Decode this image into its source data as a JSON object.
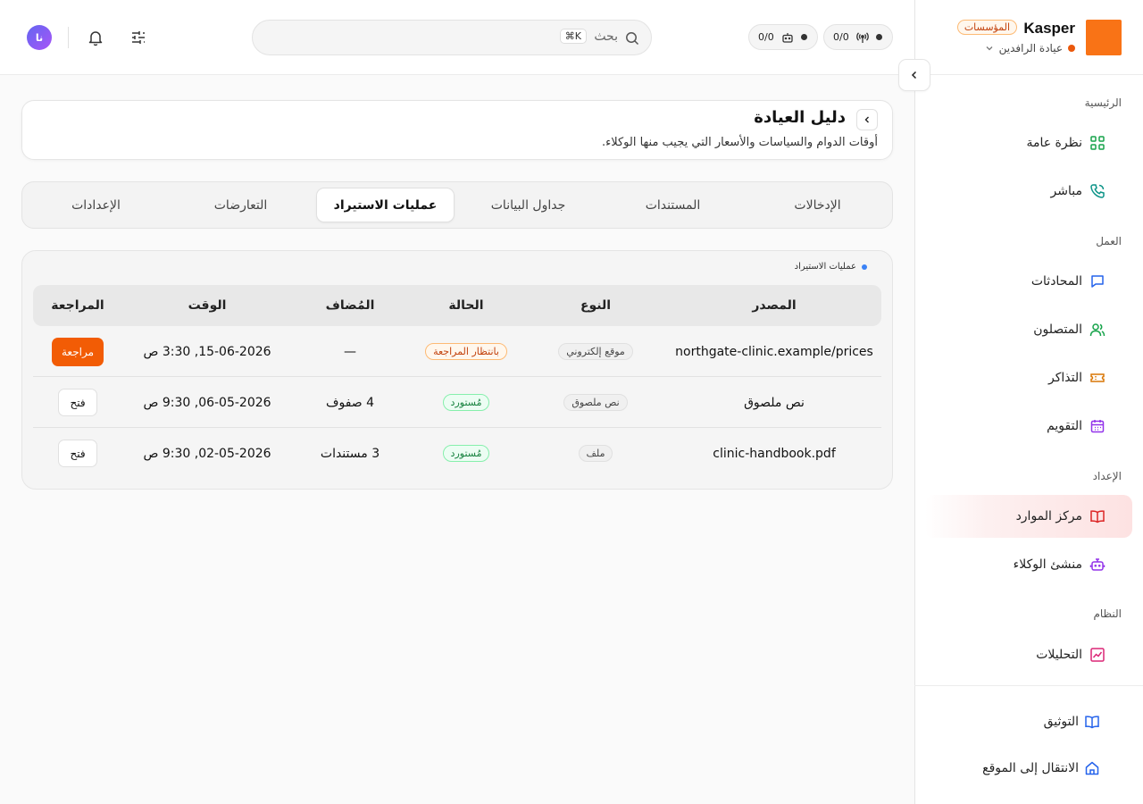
{
  "brand": {
    "name": "Kasper",
    "badge": "المؤسسات",
    "org": "عيادة الرافدين"
  },
  "colors": {
    "accent": "#f25c05",
    "active_nav": "#fde2e2",
    "pending": "#c2410c",
    "imported": "#15803d"
  },
  "topbar": {
    "status_pills": [
      {
        "icon": "antenna-icon",
        "value": "0/0"
      },
      {
        "icon": "robot-icon",
        "value": "0/0"
      }
    ],
    "search": {
      "placeholder": "بحث",
      "shortcut": "⌘K"
    },
    "avatar_initials": "نا"
  },
  "sidebar": {
    "sections": [
      {
        "label": "الرئيسية",
        "items": [
          {
            "label": "نظرة عامة",
            "icon": "grid-icon"
          },
          {
            "label": "مباشر",
            "icon": "phone-icon"
          }
        ]
      },
      {
        "label": "العمل",
        "items": [
          {
            "label": "المحادثات",
            "icon": "chat-icon"
          },
          {
            "label": "المتصلون",
            "icon": "users-icon"
          },
          {
            "label": "التذاكر",
            "icon": "ticket-icon"
          },
          {
            "label": "التقويم",
            "icon": "calendar-icon"
          }
        ]
      },
      {
        "label": "الإعداد",
        "items": [
          {
            "label": "مركز الموارد",
            "icon": "book-icon",
            "active": true
          },
          {
            "label": "منشئ الوكلاء",
            "icon": "bot-icon"
          }
        ]
      },
      {
        "label": "النظام",
        "items": [
          {
            "label": "التحليلات",
            "icon": "chart-icon"
          }
        ]
      }
    ],
    "footer": [
      {
        "label": "التوثيق",
        "icon": "book-icon"
      },
      {
        "label": "الانتقال إلى الموقع",
        "icon": "home-icon"
      }
    ]
  },
  "page": {
    "title": "دليل العيادة",
    "subtitle": "أوقات الدوام والسياسات والأسعار التي يجيب منها الوكلاء."
  },
  "tabs": [
    {
      "label": "الإدخالات"
    },
    {
      "label": "المستندات"
    },
    {
      "label": "جداول البيانات"
    },
    {
      "label": "عمليات الاستيراد",
      "active": true
    },
    {
      "label": "التعارضات"
    },
    {
      "label": "الإعدادات"
    }
  ],
  "imports": {
    "label": "عمليات الاستيراد",
    "columns": [
      "المصدر",
      "النوع",
      "الحالة",
      "المُضاف",
      "الوقت",
      "المراجعة"
    ],
    "rows": [
      {
        "source": "northgate-clinic.example/prices",
        "type": "موقع إلكتروني",
        "status": "بانتظار المراجعة",
        "status_kind": "pending",
        "added": "—",
        "time": "15-06-2026, 3:30 ص",
        "action": "مراجعة"
      },
      {
        "source": "نص ملصوق",
        "type": "نص ملصوق",
        "status": "مُستورد",
        "status_kind": "done",
        "added": "4 صفوف",
        "time": "06-05-2026, 9:30 ص",
        "action": "فتح"
      },
      {
        "source": "clinic-handbook.pdf",
        "type": "ملف",
        "status": "مُستورد",
        "status_kind": "done",
        "added": "3 مستندات",
        "time": "02-05-2026, 9:30 ص",
        "action": "فتح"
      }
    ]
  }
}
